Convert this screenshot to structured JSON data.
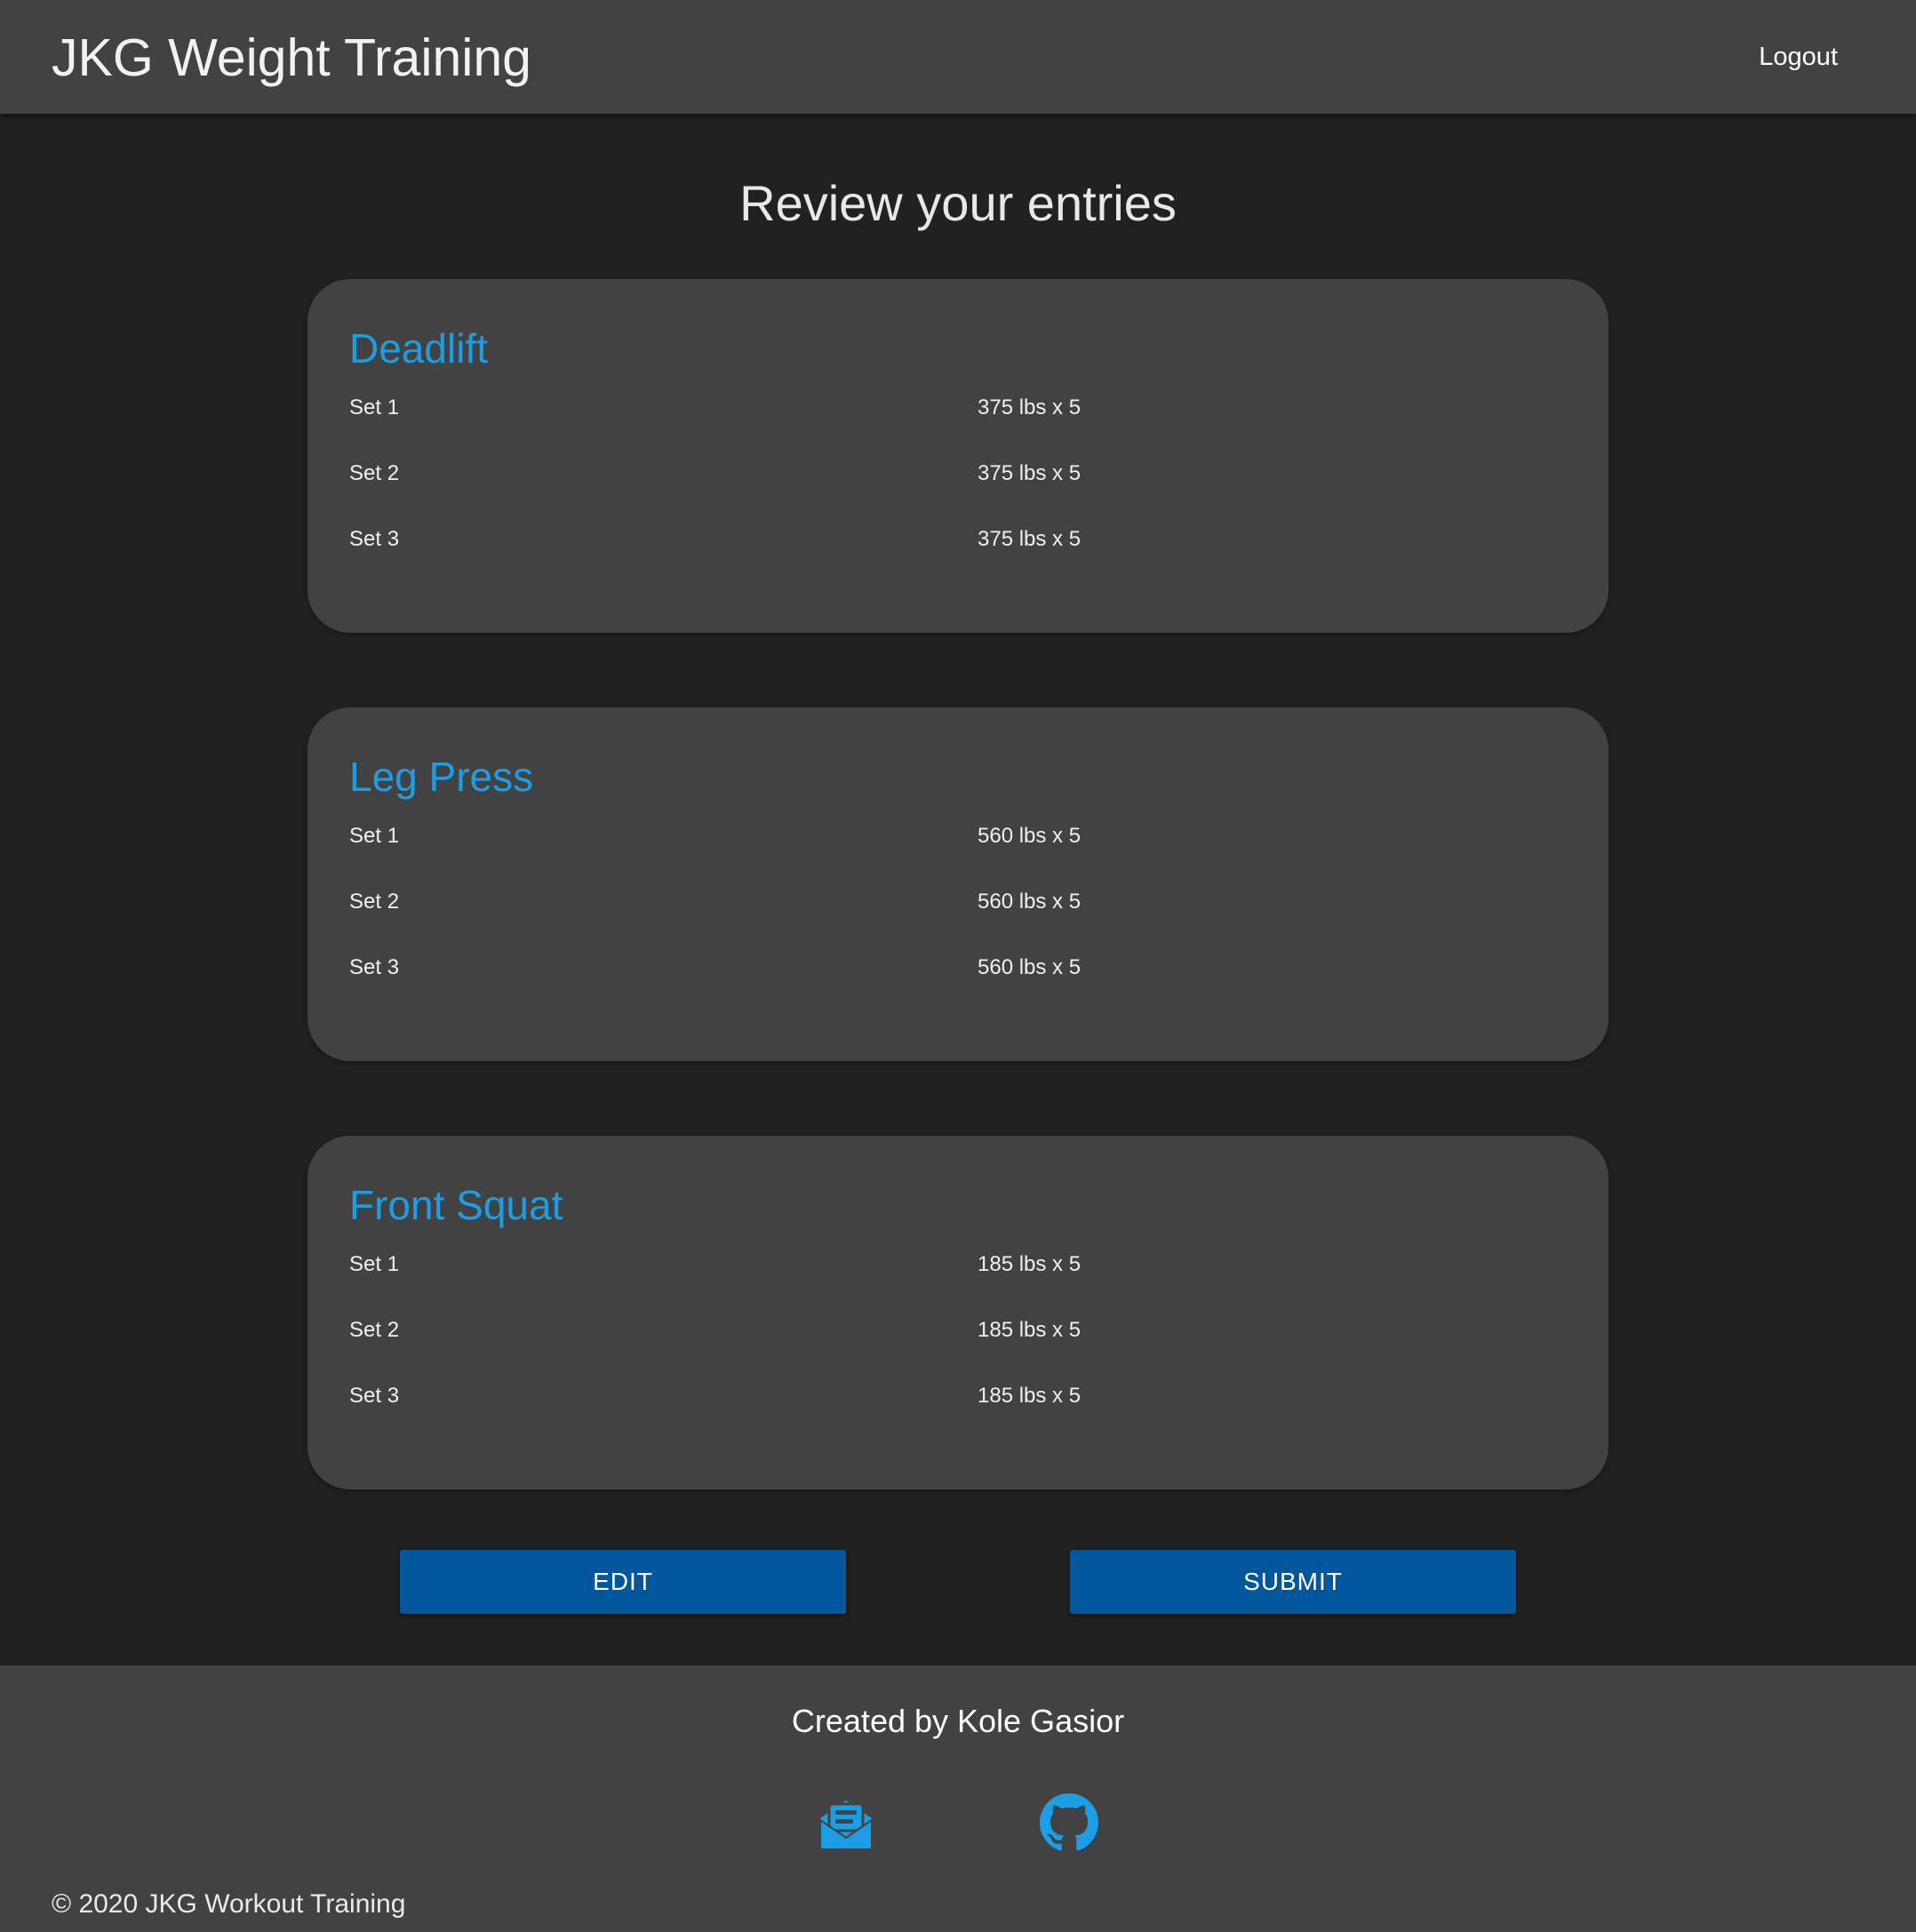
{
  "header": {
    "title": "JKG Weight Training",
    "logout_label": "Logout"
  },
  "page": {
    "title": "Review your entries"
  },
  "exercises": [
    {
      "name": "Deadlift",
      "sets": [
        {
          "label": "Set 1",
          "value": "375 lbs x 5"
        },
        {
          "label": "Set 2",
          "value": "375 lbs x 5"
        },
        {
          "label": "Set 3",
          "value": "375 lbs x 5"
        }
      ]
    },
    {
      "name": "Leg Press",
      "sets": [
        {
          "label": "Set 1",
          "value": "560 lbs x 5"
        },
        {
          "label": "Set 2",
          "value": "560 lbs x 5"
        },
        {
          "label": "Set 3",
          "value": "560 lbs x 5"
        }
      ]
    },
    {
      "name": "Front Squat",
      "sets": [
        {
          "label": "Set 1",
          "value": "185 lbs x 5"
        },
        {
          "label": "Set 2",
          "value": "185 lbs x 5"
        },
        {
          "label": "Set 3",
          "value": "185 lbs x 5"
        }
      ]
    }
  ],
  "actions": {
    "edit_label": "EDIT",
    "submit_label": "SUBMIT"
  },
  "footer": {
    "credit": "Created by Kole Gasior",
    "icons": [
      "email-open-icon",
      "github-icon"
    ],
    "copyright": "© 2020 JKG Workout Training"
  },
  "colors": {
    "background": "#212121",
    "surface": "#424242",
    "accent": "#1c9ee6",
    "button": "#01579b"
  }
}
